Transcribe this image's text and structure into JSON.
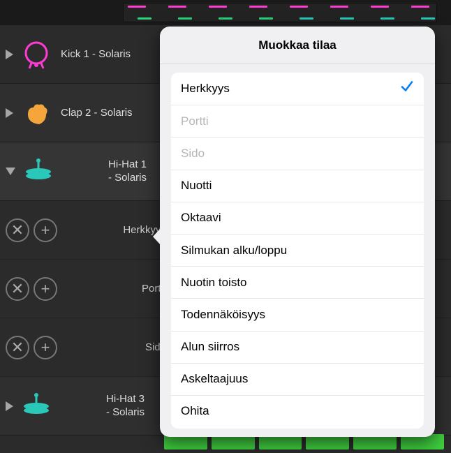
{
  "popover": {
    "title": "Muokkaa tilaa",
    "options": [
      {
        "label": "Herkkyys",
        "selected": true,
        "disabled": false
      },
      {
        "label": "Portti",
        "selected": false,
        "disabled": true
      },
      {
        "label": "Sido",
        "selected": false,
        "disabled": true
      },
      {
        "label": "Nuotti",
        "selected": false,
        "disabled": false
      },
      {
        "label": "Oktaavi",
        "selected": false,
        "disabled": false
      },
      {
        "label": "Silmukan alku/loppu",
        "selected": false,
        "disabled": false
      },
      {
        "label": "Nuotin toisto",
        "selected": false,
        "disabled": false
      },
      {
        "label": "Todennäköisyys",
        "selected": false,
        "disabled": false
      },
      {
        "label": "Alun siirros",
        "selected": false,
        "disabled": false
      },
      {
        "label": "Askeltaajuus",
        "selected": false,
        "disabled": false
      },
      {
        "label": "Ohita",
        "selected": false,
        "disabled": false
      }
    ]
  },
  "tracks": {
    "0": {
      "name": "Kick 1 - Solaris",
      "color": "#ff3bd4"
    },
    "1": {
      "name": "Clap 2 - Solaris",
      "color": "#f4a63c"
    },
    "2": {
      "name": "Hi-Hat 1\n- Solaris",
      "color": "#29c8b9"
    },
    "3": {
      "name": "Hi-Hat 3\n- Solaris",
      "color": "#29c8b9"
    }
  },
  "subrows": {
    "0": {
      "label": "Herkkyys"
    },
    "1": {
      "label": "Portti"
    },
    "2": {
      "label": "Sido"
    }
  },
  "icons": {
    "close": "✕",
    "add": "+"
  }
}
